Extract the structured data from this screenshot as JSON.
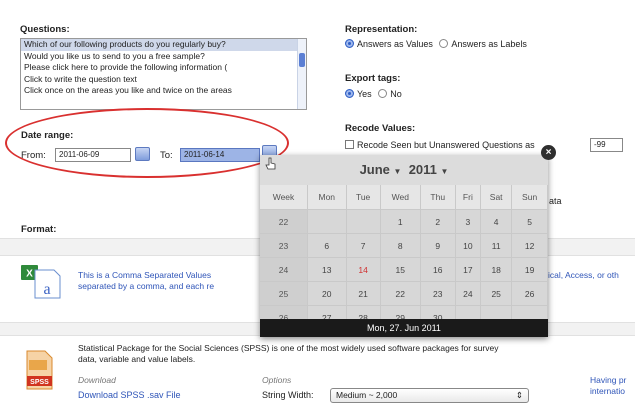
{
  "questions": {
    "heading": "Questions:",
    "items": [
      "Which of our following products do you regularly buy?",
      "Would you like us to send to you a free sample?",
      "Please click here to provide the following information (",
      "Click to write the question text",
      "Click once on the areas you like and twice on the areas"
    ]
  },
  "date_range": {
    "heading": "Date range:",
    "from_label": "From:",
    "from_value": "2011-06-09",
    "to_label": "To:",
    "to_value": "2011-06-14"
  },
  "representation": {
    "heading": "Representation:",
    "option_values": "Answers as Values",
    "option_labels": "Answers as Labels"
  },
  "export_tags": {
    "heading": "Export tags:",
    "yes": "Yes",
    "no": "No"
  },
  "recode": {
    "heading": "Recode Values:",
    "checkbox_label": "Recode Seen but Unanswered Questions as",
    "value": "-99",
    "ata_fragment": "ata"
  },
  "format": {
    "heading": "Format:",
    "csv_text_line1": "This is a Comma Separated Values",
    "csv_text_line2": "separated by a comma, and each re",
    "csv_right_text": "ical, Access, or oth",
    "spss_title_line1": "Statistical Package for the Social Sciences (SPSS) is one of the most widely used software packages for survey",
    "spss_title_line2": "data, variable and value labels.",
    "download_label": "Download",
    "download_link": "Download SPSS .sav File",
    "options_label": "Options",
    "string_width_label": "String Width:",
    "string_width_value": "Medium ~ 2,000",
    "having_line1": "Having pr",
    "having_line2": "internatio"
  },
  "calendar": {
    "month": "June",
    "year": "2011",
    "headers": [
      "Week",
      "Mon",
      "Tue",
      "Wed",
      "Thu",
      "Fri",
      "Sat",
      "Sun"
    ],
    "rows": [
      [
        "22",
        "",
        "",
        "1",
        "2",
        "3",
        "4",
        "5"
      ],
      [
        "23",
        "6",
        "7",
        "8",
        "9",
        "10",
        "11",
        "12"
      ],
      [
        "24",
        "13",
        "14",
        "15",
        "16",
        "17",
        "18",
        "19"
      ],
      [
        "25",
        "20",
        "21",
        "22",
        "23",
        "24",
        "25",
        "26"
      ],
      [
        "26",
        "27",
        "28",
        "29",
        "30",
        "",
        "",
        ""
      ]
    ],
    "today": "14",
    "footer": "Mon, 27. Jun 2011",
    "close_glyph": "×",
    "accent": "#d03030"
  }
}
